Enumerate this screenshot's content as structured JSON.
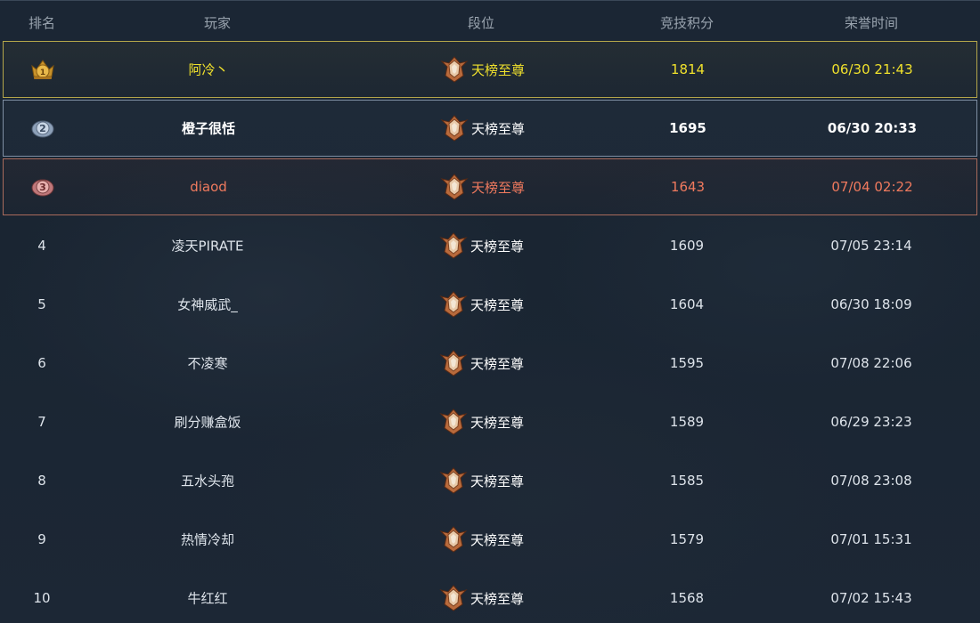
{
  "header": {
    "rank": "排名",
    "player": "玩家",
    "tier": "段位",
    "score": "竞技积分",
    "time": "荣誉时间"
  },
  "colors": {
    "first": "#f0e12c",
    "second": "#ffffff",
    "third": "#f07a5e",
    "default": "#dde3ea"
  },
  "rows": [
    {
      "rank": "",
      "medal": "gold-medal-1-icon",
      "player": "阿冷丶",
      "tier": "天榜至尊",
      "score": "1814",
      "time": "06/30 21:43"
    },
    {
      "rank": "",
      "medal": "silver-medal-2-icon",
      "player": "橙子很恬",
      "tier": "天榜至尊",
      "score": "1695",
      "time": "06/30 20:33"
    },
    {
      "rank": "",
      "medal": "bronze-medal-3-icon",
      "player": "diaod",
      "tier": "天榜至尊",
      "score": "1643",
      "time": "07/04 02:22"
    },
    {
      "rank": "4",
      "player": "凌天PIRATE",
      "tier": "天榜至尊",
      "score": "1609",
      "time": "07/05 23:14"
    },
    {
      "rank": "5",
      "player": "女神威武_",
      "tier": "天榜至尊",
      "score": "1604",
      "time": "06/30 18:09"
    },
    {
      "rank": "6",
      "player": "不凌寒",
      "tier": "天榜至尊",
      "score": "1595",
      "time": "07/08 22:06"
    },
    {
      "rank": "7",
      "player": "刷分赚盒饭",
      "tier": "天榜至尊",
      "score": "1589",
      "time": "06/29 23:23"
    },
    {
      "rank": "8",
      "player": "五水头孢",
      "tier": "天榜至尊",
      "score": "1585",
      "time": "07/08 23:08"
    },
    {
      "rank": "9",
      "player": "热情冷却",
      "tier": "天榜至尊",
      "score": "1579",
      "time": "07/01 15:31"
    },
    {
      "rank": "10",
      "player": "牛红红",
      "tier": "天榜至尊",
      "score": "1568",
      "time": "07/02 15:43"
    }
  ]
}
